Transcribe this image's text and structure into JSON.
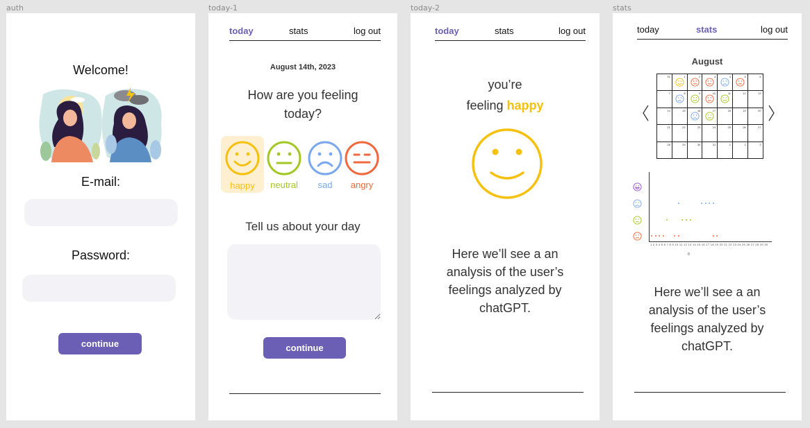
{
  "frames": {
    "auth": "auth",
    "today1": "today-1",
    "today2": "today-2",
    "stats": "stats"
  },
  "nav": {
    "today": "today",
    "stats": "stats",
    "logout": "log out"
  },
  "colors": {
    "accent": "#6a5fb5",
    "happy": "#f5c10e",
    "neutral": "#a3c724",
    "sad": "#7aa8f0",
    "angry": "#f0683c",
    "excited": "#9b4fd6"
  },
  "auth": {
    "welcome": "Welcome!",
    "email_label": "E-mail:",
    "email_value": "",
    "password_label": "Password:",
    "password_value": "",
    "continue": "continue"
  },
  "today1": {
    "date": "August 14th, 2023",
    "question": "How are you feeling today?",
    "moods": [
      {
        "label": "happy",
        "icon": "happy-face-icon",
        "selected": true
      },
      {
        "label": "neutral",
        "icon": "neutral-face-icon",
        "selected": false
      },
      {
        "label": "sad",
        "icon": "sad-face-icon",
        "selected": false
      },
      {
        "label": "angry",
        "icon": "angry-face-icon",
        "selected": false
      }
    ],
    "tell_label": "Tell us about your day",
    "day_text": "",
    "continue": "continue"
  },
  "today2": {
    "line1": "you’re",
    "line2_prefix": "feeling ",
    "mood": "happy",
    "analysis": "Here we’ll see a an analysis of the user’s feelings analyzed by chatGPT."
  },
  "stats": {
    "month": "August",
    "prev_icon": "chevron-left-icon",
    "next_icon": "chevron-right-icon",
    "calendar_weeks": [
      [
        {
          "d": "31",
          "m": ""
        },
        {
          "d": "1",
          "m": "happy"
        },
        {
          "d": "2",
          "m": "angry"
        },
        {
          "d": "3",
          "m": "angry"
        },
        {
          "d": "4",
          "m": "sad"
        },
        {
          "d": "5",
          "m": "angry"
        },
        {
          "d": "6",
          "m": ""
        }
      ],
      [
        {
          "d": "7",
          "m": ""
        },
        {
          "d": "8",
          "m": "sad"
        },
        {
          "d": "9",
          "m": "neutral"
        },
        {
          "d": "10",
          "m": "angry"
        },
        {
          "d": "11",
          "m": "neutral"
        },
        {
          "d": "12",
          "m": ""
        },
        {
          "d": "13",
          "m": ""
        }
      ],
      [
        {
          "d": "14",
          "m": ""
        },
        {
          "d": "15",
          "m": ""
        },
        {
          "d": "16",
          "m": "sad"
        },
        {
          "d": "17",
          "m": "neutral"
        },
        {
          "d": "18",
          "m": ""
        },
        {
          "d": "19",
          "m": ""
        },
        {
          "d": "20",
          "m": ""
        }
      ],
      [
        {
          "d": "21",
          "m": ""
        },
        {
          "d": "22",
          "m": ""
        },
        {
          "d": "23",
          "m": ""
        },
        {
          "d": "24",
          "m": ""
        },
        {
          "d": "25",
          "m": ""
        },
        {
          "d": "26",
          "m": ""
        },
        {
          "d": "27",
          "m": ""
        }
      ],
      [
        {
          "d": "28",
          "m": ""
        },
        {
          "d": "29",
          "m": ""
        },
        {
          "d": "30",
          "m": ""
        },
        {
          "d": "31",
          "m": ""
        },
        {
          "d": "1",
          "m": ""
        },
        {
          "d": "2",
          "m": ""
        },
        {
          "d": "3",
          "m": ""
        }
      ]
    ],
    "graph_rows": [
      {
        "mood": "excited",
        "icon": "excited-face-icon",
        "days": []
      },
      {
        "mood": "sad",
        "icon": "sad-face-icon",
        "days": [
          8,
          14,
          15,
          16,
          17
        ]
      },
      {
        "mood": "neutral",
        "icon": "neutral-face-icon",
        "days": [
          5,
          9,
          10,
          11
        ]
      },
      {
        "mood": "angry",
        "icon": "angry-face-icon",
        "days": [
          1,
          2,
          3,
          4,
          7,
          8,
          17,
          18
        ]
      }
    ],
    "x_ticks": "1 2 3 4 5 6 7 8 9 10 11 12 13 14 15 16 17 18 19 20 21 22 23 24 25 26 27 28 29 30",
    "x_zero": "0",
    "analysis": "Here we’ll see a an analysis of the user’s feelings analyzed by chatGPT."
  }
}
